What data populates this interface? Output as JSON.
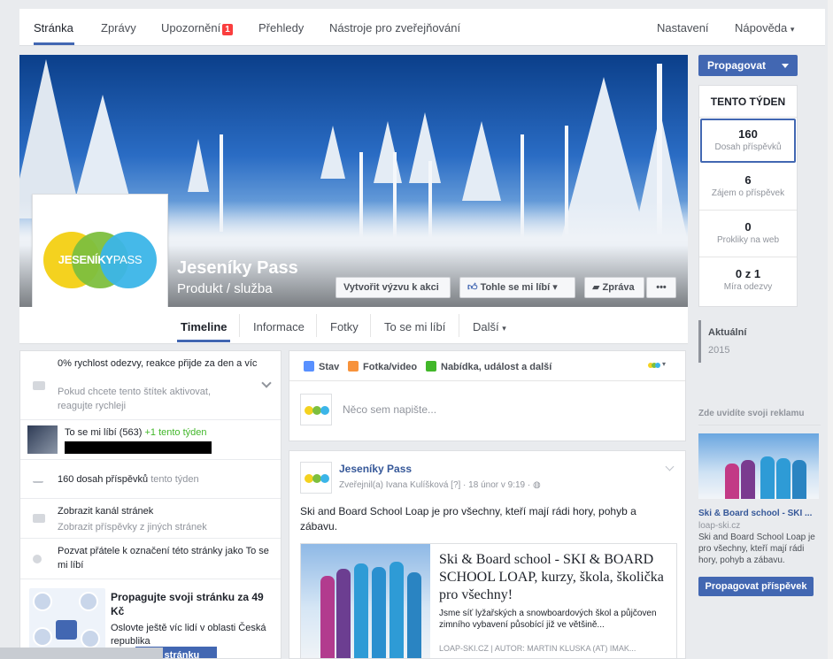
{
  "topnav": {
    "items": [
      "Stránka",
      "Zprávy",
      "Upozornění",
      "Přehledy",
      "Nástroje pro zveřejňování"
    ],
    "notification_count": "1",
    "settings": "Nastavení",
    "help": "Nápověda"
  },
  "page": {
    "name": "Jeseníky Pass",
    "category": "Produkt / služba",
    "logo_text_bold": "JESENÍKY",
    "logo_text_light": "PASS"
  },
  "cover_buttons": {
    "challenge": "Vytvořit výzvu k akci",
    "like": "Tohle se mi líbí",
    "message": "Zpráva",
    "more": "•••"
  },
  "tabs": [
    "Timeline",
    "Informace",
    "Fotky",
    "To se mi líbí",
    "Další"
  ],
  "right_rail": {
    "promote": "Propagovat",
    "week_header": "TENTO TÝDEN",
    "stats": [
      {
        "value": "160",
        "label": "Dosah příspěvků"
      },
      {
        "value": "6",
        "label": "Zájem o příspěvek"
      },
      {
        "value": "0",
        "label": "Prokliky na web"
      },
      {
        "value": "0 z 1",
        "label": "Míra odezvy"
      }
    ],
    "timeline_current": "Aktuální",
    "timeline_year": "2015",
    "ad_header": "Zde uvidíte svoji reklamu",
    "ad_title": "Ski & Board school - SKI ...",
    "ad_url": "loap-ski.cz",
    "ad_text": "Ski and Board School Loap je pro všechny, kteří mají rádi hory, pohyb a zábavu.",
    "ad_button": "Propagovat příspěvek"
  },
  "left": {
    "response_line1": "0% rychlost odezvy, reakce přijde za den a víc",
    "response_line2": "Pokud chcete tento štítek aktivovat, reagujte rychleji",
    "likes_text": "To se mi líbí (563)",
    "likes_delta": "+1 tento týden",
    "reach_text": "160 dosah příspěvků",
    "reach_period": "tento týden",
    "feed_line1": "Zobrazit kanál stránek",
    "feed_line2": "Zobrazit příspěvky z jiných stránek",
    "invite": "Pozvat přátele k označení této stránky jako To se mi líbí",
    "promo_title": "Propagujte svoji stránku za 49 Kč",
    "promo_text": "Oslovte ještě víc lidí v oblasti Česká republika",
    "promo_button": "at stránku"
  },
  "composer": {
    "status": "Stav",
    "photo": "Fotka/video",
    "offer": "Nabídka, událost a další",
    "placeholder": "Něco sem napište..."
  },
  "post": {
    "author": "Jeseníky Pass",
    "meta": "Zveřejnil(a) Ivana Kulíšková [?] · 18 únor v 9:19 · ",
    "text": "Ski and Board School Loap je pro všechny, kteří mají rádi hory, pohyb a zábavu.",
    "link_title": "Ski & Board school - SKI & BOARD SCHOOL LOAP, kurzy, škola, školička pro všechny!",
    "link_desc": "Jsme síť lyžařských a snowboardových škol a půjčoven zimního vybavení působící již ve většině...",
    "link_source": "LOAP-SKI.CZ | AUTOR: MARTIN KLUSKA (AT) IMAK..."
  },
  "colors": {
    "accent": "#4267b2",
    "link": "#365899",
    "badge": "#fa3e3e"
  }
}
